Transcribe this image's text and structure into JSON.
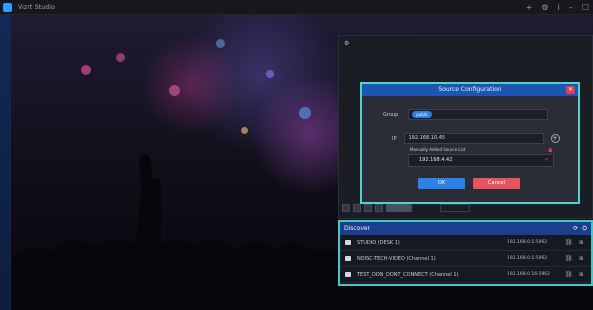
{
  "app": {
    "title": "Vizrt Studio"
  },
  "dialog": {
    "title": "Source Configuration",
    "group_label": "Group",
    "group_chip": "public",
    "ip_label": "IP",
    "ip_value": "192.168.10.45",
    "manual_label": "Manually Added Source List",
    "manual_value": "192.168.4.42",
    "ok_label": "OK",
    "cancel_label": "Cancel"
  },
  "discover": {
    "title": "Discover",
    "rows": [
      {
        "name": "STUDIO (DESK 1)",
        "ip": "192.168.0.5:5962"
      },
      {
        "name": "NDISC-TECH-VIDEO (Channel 1)",
        "ip": "192.168.0.5:5962"
      },
      {
        "name": "TEST_DON_DONT_CONNECT (Channel 1)",
        "ip": "192.168.0.16:5962"
      }
    ]
  },
  "icons": {
    "app": "app-logo-icon",
    "add": "add-circle-icon",
    "warning": "warning-icon",
    "close": "close-icon",
    "monitor": "monitor-icon"
  },
  "colors": {
    "accent": "#46c7c8",
    "primary": "#2f7fe8",
    "danger": "#e6545e"
  }
}
